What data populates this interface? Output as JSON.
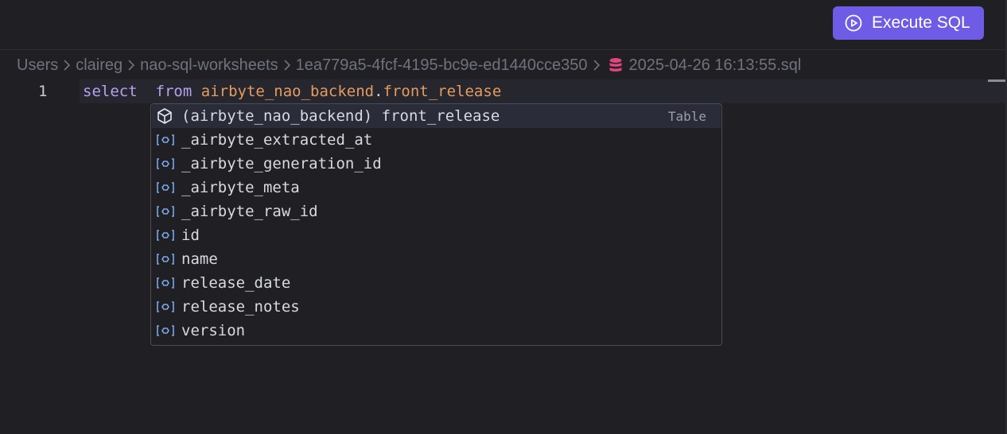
{
  "toolbar": {
    "execute_label": "Execute SQL",
    "execute_icon": "play-circle-icon",
    "accent_color": "#6f5ce6"
  },
  "breadcrumb": {
    "items": [
      "Users",
      "claireg",
      "nao-sql-worksheets",
      "1ea779a5-4fcf-4195-bc9e-ed1440cce350"
    ],
    "file_name": "2025-04-26 16:13:55.sql",
    "file_icon": "database-icon"
  },
  "editor": {
    "line_number": "1",
    "tokens": {
      "select": "select",
      "from": "from",
      "schema": "airbyte_nao_backend",
      "dot": ".",
      "table": "front_release"
    }
  },
  "suggestions": {
    "items": [
      {
        "label": "(airbyte_nao_backend) front_release",
        "kind": "Table",
        "icon": "table-cube-icon"
      },
      {
        "label": "_airbyte_extracted_at",
        "icon": "field-icon"
      },
      {
        "label": "_airbyte_generation_id",
        "icon": "field-icon"
      },
      {
        "label": "_airbyte_meta",
        "icon": "field-icon"
      },
      {
        "label": "_airbyte_raw_id",
        "icon": "field-icon"
      },
      {
        "label": "id",
        "icon": "field-icon"
      },
      {
        "label": "name",
        "icon": "field-icon"
      },
      {
        "label": "release_date",
        "icon": "field-icon"
      },
      {
        "label": "release_notes",
        "icon": "field-icon"
      },
      {
        "label": "version",
        "icon": "field-icon"
      }
    ]
  }
}
